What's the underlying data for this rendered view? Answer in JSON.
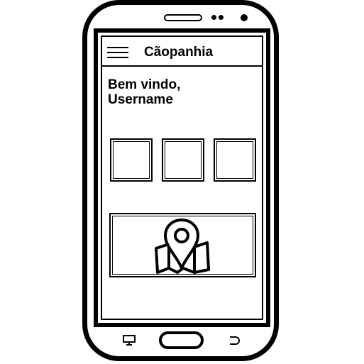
{
  "app": {
    "title": "Cãopanhia",
    "welcome_line1": "Bem vindo,",
    "welcome_line2": "Username"
  },
  "tiles": [
    {
      "name": "tile-1"
    },
    {
      "name": "tile-2"
    },
    {
      "name": "tile-3"
    }
  ],
  "icons": {
    "menu": "hamburger-menu-icon",
    "map": "map-location-icon",
    "recent": "recent-apps-icon",
    "back": "back-icon"
  },
  "colors": {
    "stroke": "#000000",
    "background": "#ffffff"
  }
}
